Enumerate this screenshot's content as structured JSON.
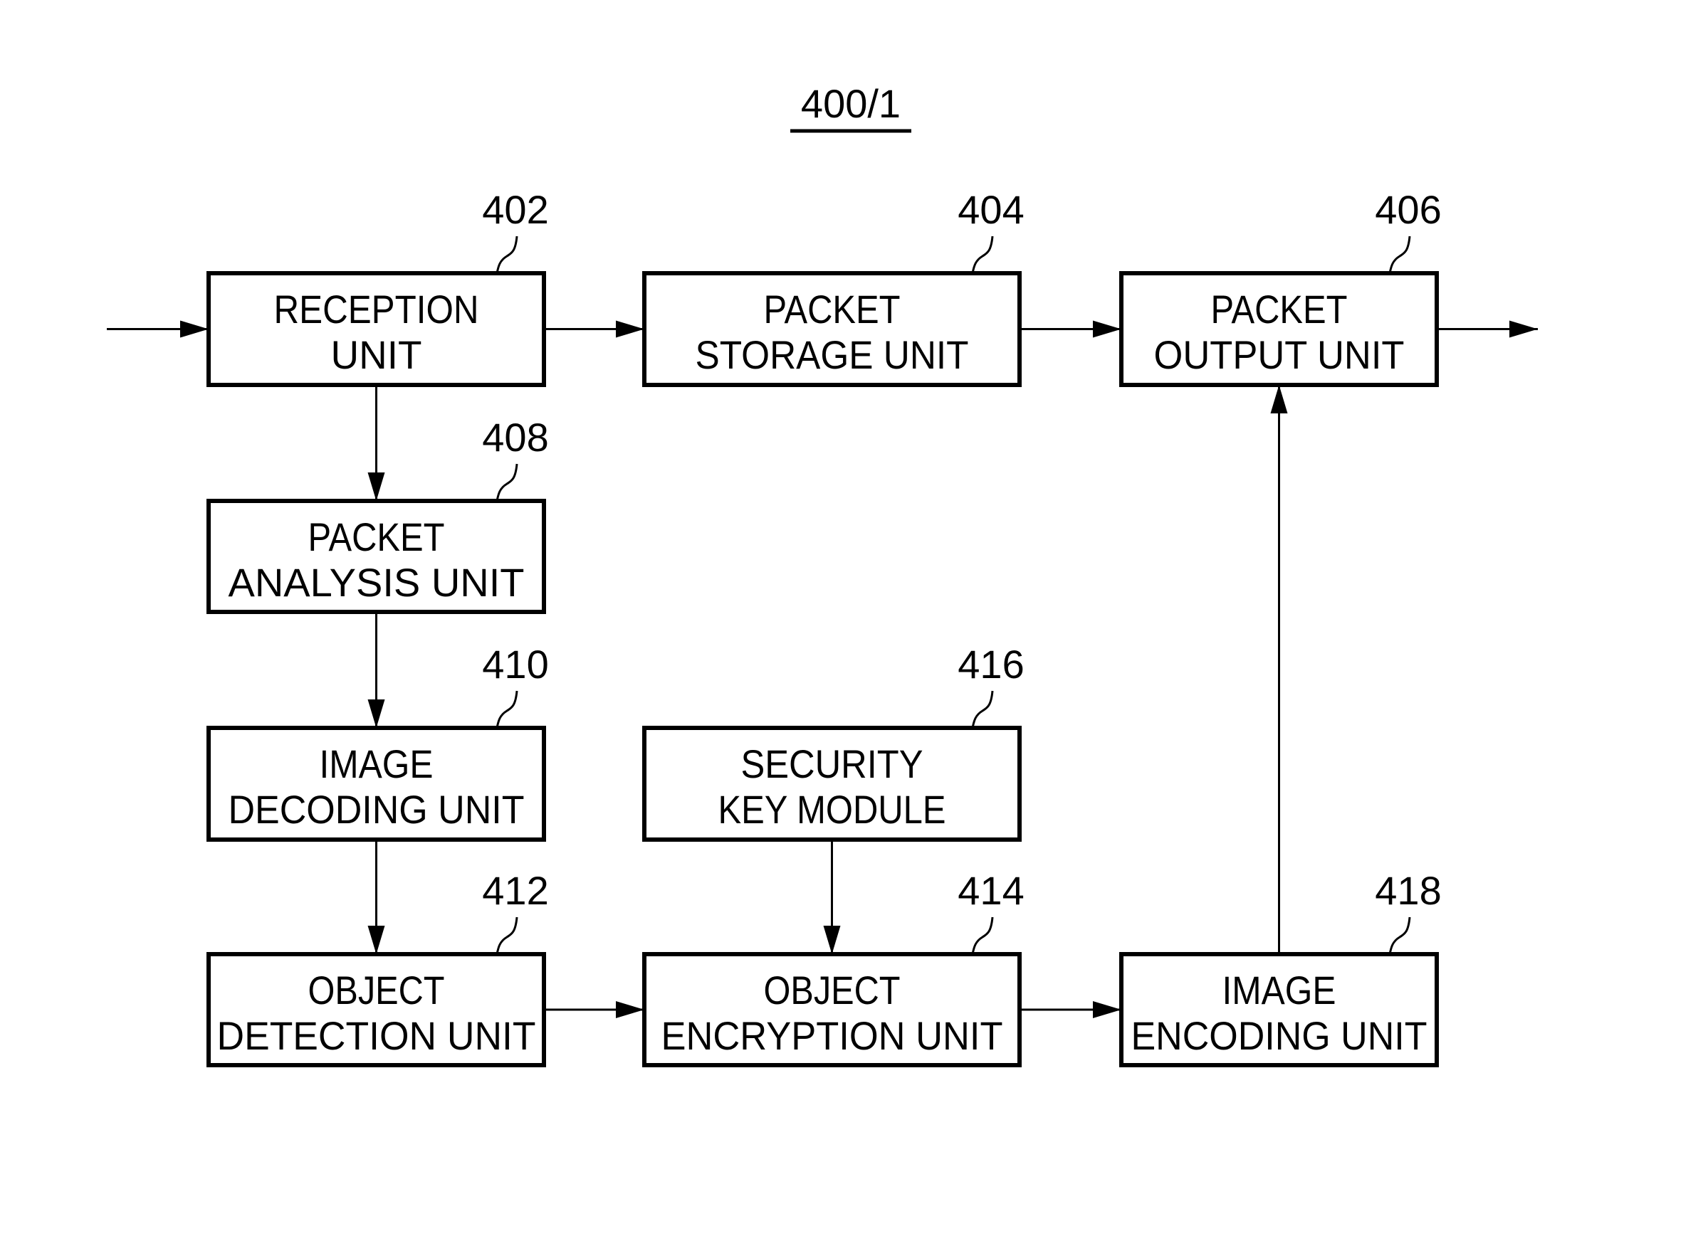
{
  "figure": {
    "title": "400/1",
    "blocks": [
      {
        "id": "402",
        "lines": [
          "RECEPTION",
          "UNIT"
        ]
      },
      {
        "id": "404",
        "lines": [
          "PACKET",
          "STORAGE UNIT"
        ]
      },
      {
        "id": "406",
        "lines": [
          "PACKET",
          "OUTPUT UNIT"
        ]
      },
      {
        "id": "408",
        "lines": [
          "PACKET",
          "ANALYSIS UNIT"
        ]
      },
      {
        "id": "410",
        "lines": [
          "IMAGE",
          "DECODING UNIT"
        ]
      },
      {
        "id": "416",
        "lines": [
          "SECURITY",
          "KEY MODULE"
        ]
      },
      {
        "id": "412",
        "lines": [
          "OBJECT",
          "DETECTION UNIT"
        ]
      },
      {
        "id": "414",
        "lines": [
          "OBJECT",
          "ENCRYPTION UNIT"
        ]
      },
      {
        "id": "418",
        "lines": [
          "IMAGE",
          "ENCODING UNIT"
        ]
      }
    ],
    "connections": [
      {
        "from": "input",
        "to": "402"
      },
      {
        "from": "402",
        "to": "404"
      },
      {
        "from": "404",
        "to": "406"
      },
      {
        "from": "406",
        "to": "output"
      },
      {
        "from": "402",
        "to": "408"
      },
      {
        "from": "408",
        "to": "410"
      },
      {
        "from": "410",
        "to": "412"
      },
      {
        "from": "416",
        "to": "414"
      },
      {
        "from": "412",
        "to": "414"
      },
      {
        "from": "414",
        "to": "418"
      },
      {
        "from": "418",
        "to": "406"
      }
    ]
  }
}
